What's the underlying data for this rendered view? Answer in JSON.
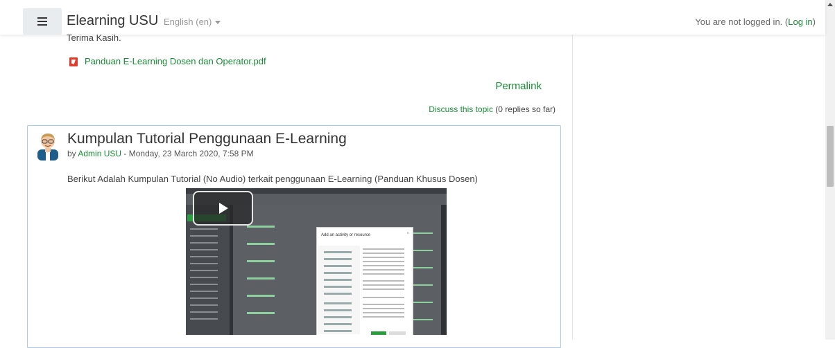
{
  "navbar": {
    "menu_icon": "hamburger-menu-icon",
    "brand": "Elearning USU",
    "language": "English (en)",
    "login_text": "You are not logged in. (",
    "login_link": "Log in",
    "login_close": ")"
  },
  "previous_post": {
    "closing_text": "Terima Kasih.",
    "attachment_icon": "pdf-icon",
    "attachment": "Panduan E-Learning Dosen dan Operator.pdf",
    "permalink": "Permalink",
    "discuss_link": "Discuss this topic",
    "replies": "(0 replies so far)"
  },
  "post": {
    "title": "Kumpulan Tutorial Penggunaan E-Learning",
    "by_prefix": "by",
    "author": "Admin USU",
    "date": "- Monday, 23 March 2020, 7:58 PM",
    "body": "Berikut Adalah Kumpulan Tutorial (No Audio) terkait penggunaan E-Learning (Panduan Khusus Dosen)",
    "video": {
      "play_icon": "play-icon",
      "modal_title": "Add an activity or resource"
    }
  },
  "colors": {
    "link": "#1a8a36",
    "post_border": "#a9c9ec"
  }
}
